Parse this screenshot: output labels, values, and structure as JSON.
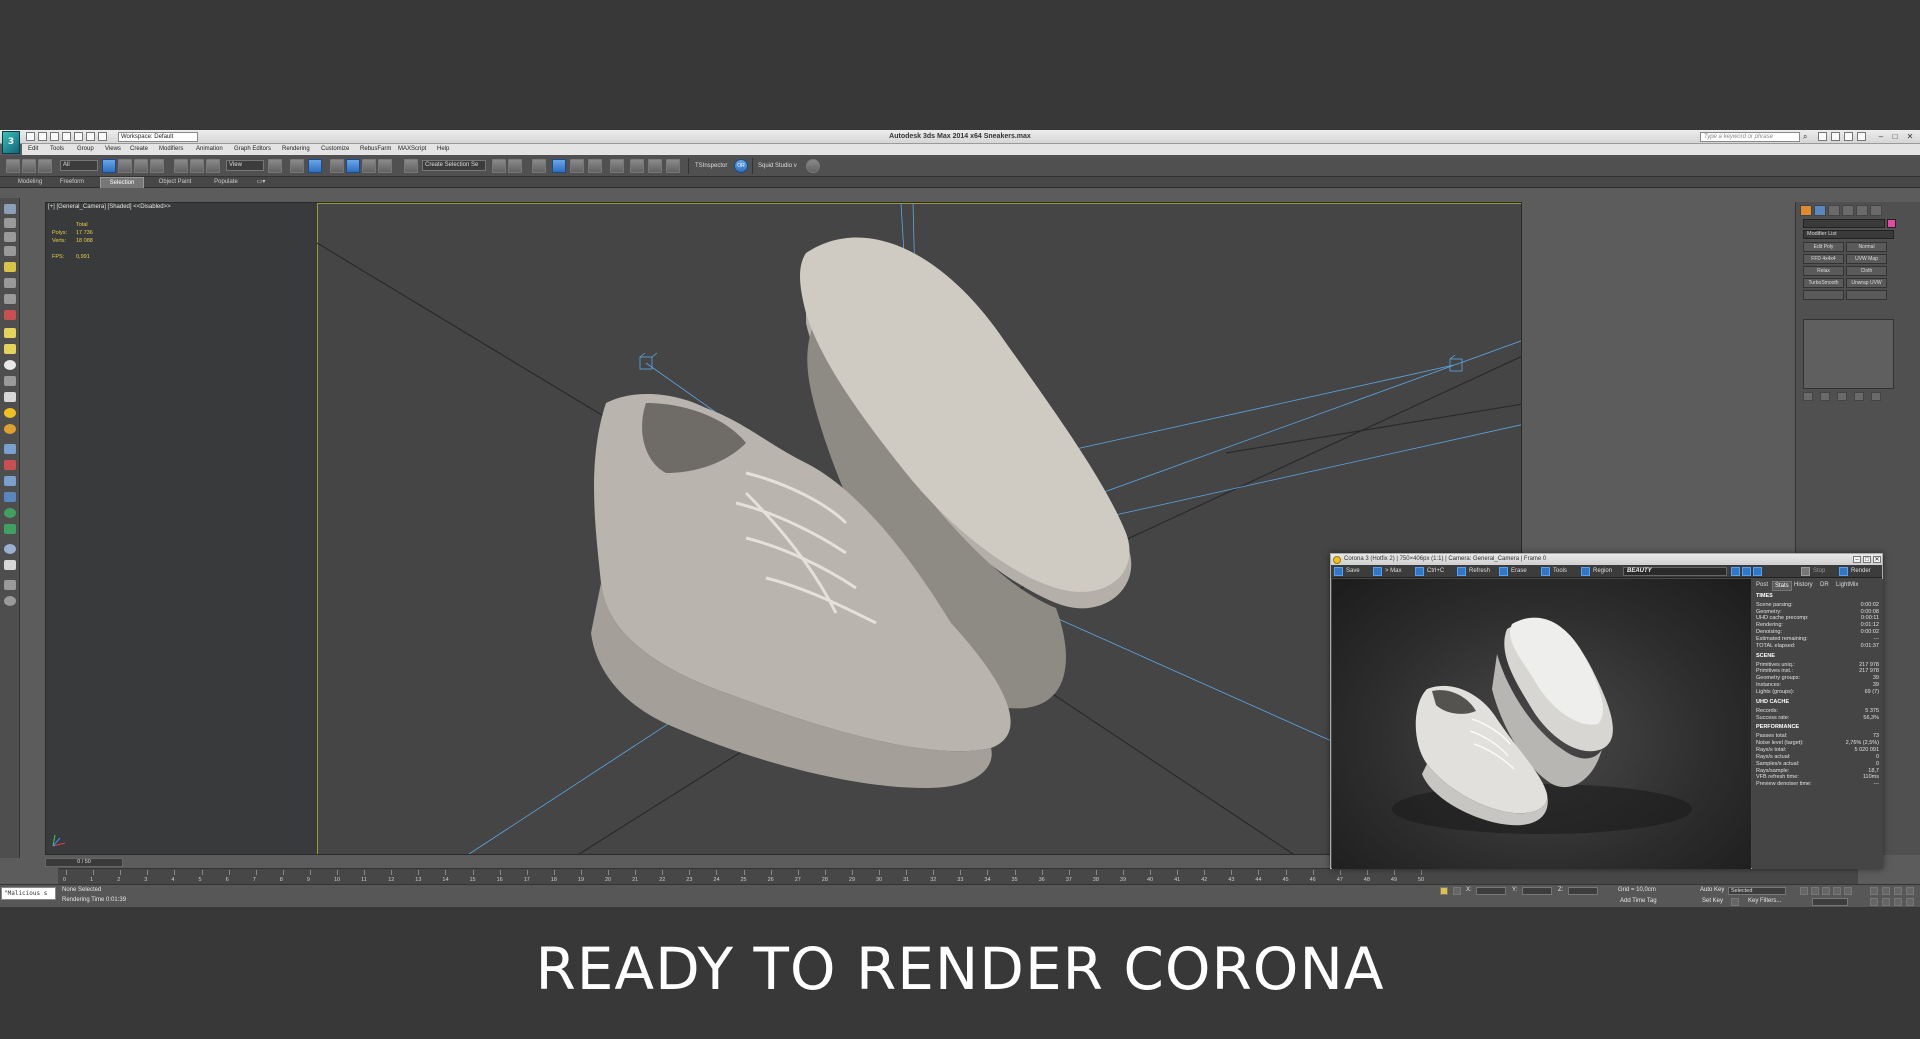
{
  "app": {
    "title": "Autodesk 3ds Max  2014 x64    Sneakers.max",
    "workspace": "Workspace: Default",
    "search_placeholder": "Type a keyword or phrase"
  },
  "menu": [
    "Edit",
    "Tools",
    "Group",
    "Views",
    "Create",
    "Modifiers",
    "Animation",
    "Graph Editors",
    "Rendering",
    "Customize",
    "RebusFarm",
    "MAXScript",
    "Help"
  ],
  "toolbar": {
    "filter": "All",
    "coord_system": "View",
    "selection_set": "Create Selection Se",
    "ts_inspector": "TSInspector",
    "or_label": "OR",
    "squid_studio": "Squid Studio v"
  },
  "ribbon_tabs": [
    "Modeling",
    "Freeform",
    "Selection",
    "Object Paint",
    "Populate"
  ],
  "viewport": {
    "label": "[+] [General_Camera] [Shaded] <<Disabled>>",
    "stats": {
      "total_label": "Total",
      "polys_label": "Polys:",
      "polys": "17 736",
      "verts_label": "Verts:",
      "verts": "18 088",
      "fps_label": "FPS:",
      "fps": "0,991"
    }
  },
  "command_panel": {
    "modifier_list": "Modifier List",
    "buttons": [
      "Edit Poly",
      "Normal",
      "FFD 4x4x4",
      "UVW Map",
      "Relax",
      "Cloth",
      "TurboSmooth",
      "Unwrap UVW"
    ]
  },
  "timeline": {
    "slider": "0 / 50",
    "ticks": [
      "0",
      "1",
      "2",
      "3",
      "4",
      "5",
      "6",
      "7",
      "8",
      "9",
      "10",
      "11",
      "12",
      "13",
      "14",
      "15",
      "16",
      "17",
      "18",
      "19",
      "20",
      "21",
      "22",
      "23",
      "24",
      "25",
      "26",
      "27",
      "28",
      "29",
      "30",
      "31",
      "32",
      "33",
      "34",
      "35",
      "36",
      "37",
      "38",
      "39",
      "40",
      "41",
      "42",
      "43",
      "44",
      "45",
      "46",
      "47",
      "48",
      "49",
      "50"
    ]
  },
  "status": {
    "maxscript": "\"Malicious s",
    "selection": "None Selected",
    "render_time": "Rendering Time  0:01:39",
    "x_label": "X:",
    "y_label": "Y:",
    "z_label": "Z:",
    "grid": "Grid = 10,0cm",
    "auto_key": "Auto Key",
    "selected": "Selected",
    "set_key": "Set Key",
    "key_filters": "Key Filters...",
    "add_time_tag": "Add Time Tag"
  },
  "vfb": {
    "title": "Corona 3 (Hotfix 2) | 750×406px (1:1) | Camera: General_Camera | Frame 0",
    "toolbar": {
      "save": "Save",
      "max": "> Max",
      "ctrlc": "Ctrl+C",
      "refresh": "Refresh",
      "erase": "Erase",
      "tools": "Tools",
      "region": "Region",
      "pass": "BEAUTY",
      "stop": "Stop",
      "render": "Render"
    },
    "tabs": [
      "Post",
      "Stats",
      "History",
      "DR",
      "LightMix"
    ],
    "active_tab": "Stats",
    "sections": [
      {
        "title": "TIMES",
        "rows": [
          [
            "Scene parsing:",
            "0:00:02"
          ],
          [
            "Geometry:",
            "0:00:08"
          ],
          [
            "UHD cache precomp:",
            "0:00:11"
          ],
          [
            "Rendering:",
            "0:01:12"
          ],
          [
            "Denoising:",
            "0:00:02"
          ],
          [
            "Estimated remaining:",
            "---"
          ],
          [
            "TOTAL elapsed:",
            "0:01:37"
          ]
        ]
      },
      {
        "title": "SCENE",
        "rows": [
          [
            "Primitives uniq.:",
            "217 978"
          ],
          [
            "Primitives inst.:",
            "217 978"
          ],
          [
            "Geometry groups:",
            "39"
          ],
          [
            "Instances:",
            "39"
          ],
          [
            "Lights (groups):",
            "69 (7)"
          ]
        ]
      },
      {
        "title": "UHD CACHE",
        "rows": [
          [
            "Records:",
            "5 375"
          ],
          [
            "Success rate:",
            "56,3%"
          ]
        ]
      },
      {
        "title": "PERFORMANCE",
        "rows": [
          [
            "Passes total:",
            "73"
          ],
          [
            "Noise level (target):",
            "2,76% (2,5%)"
          ],
          [
            "Rays/s total:",
            "5 020 091"
          ],
          [
            "Rays/s actual:",
            "0"
          ],
          [
            "Samples/s actual:",
            "0"
          ],
          [
            "Rays/sample:",
            "18,7"
          ],
          [
            "VFB refresh time:",
            "110ms"
          ],
          [
            "Preview denoiser time:",
            "---"
          ]
        ]
      }
    ]
  },
  "caption": "READY TO RENDER CORONA",
  "colors": {
    "background": "#383838",
    "viewport": "#454545",
    "safe_frame": "#9c9a2d",
    "stats_text": "#e8d14a",
    "camera_lines": "#5aa8e6",
    "shoe": "#cfcac2",
    "accent_blue": "#2f77c9"
  }
}
